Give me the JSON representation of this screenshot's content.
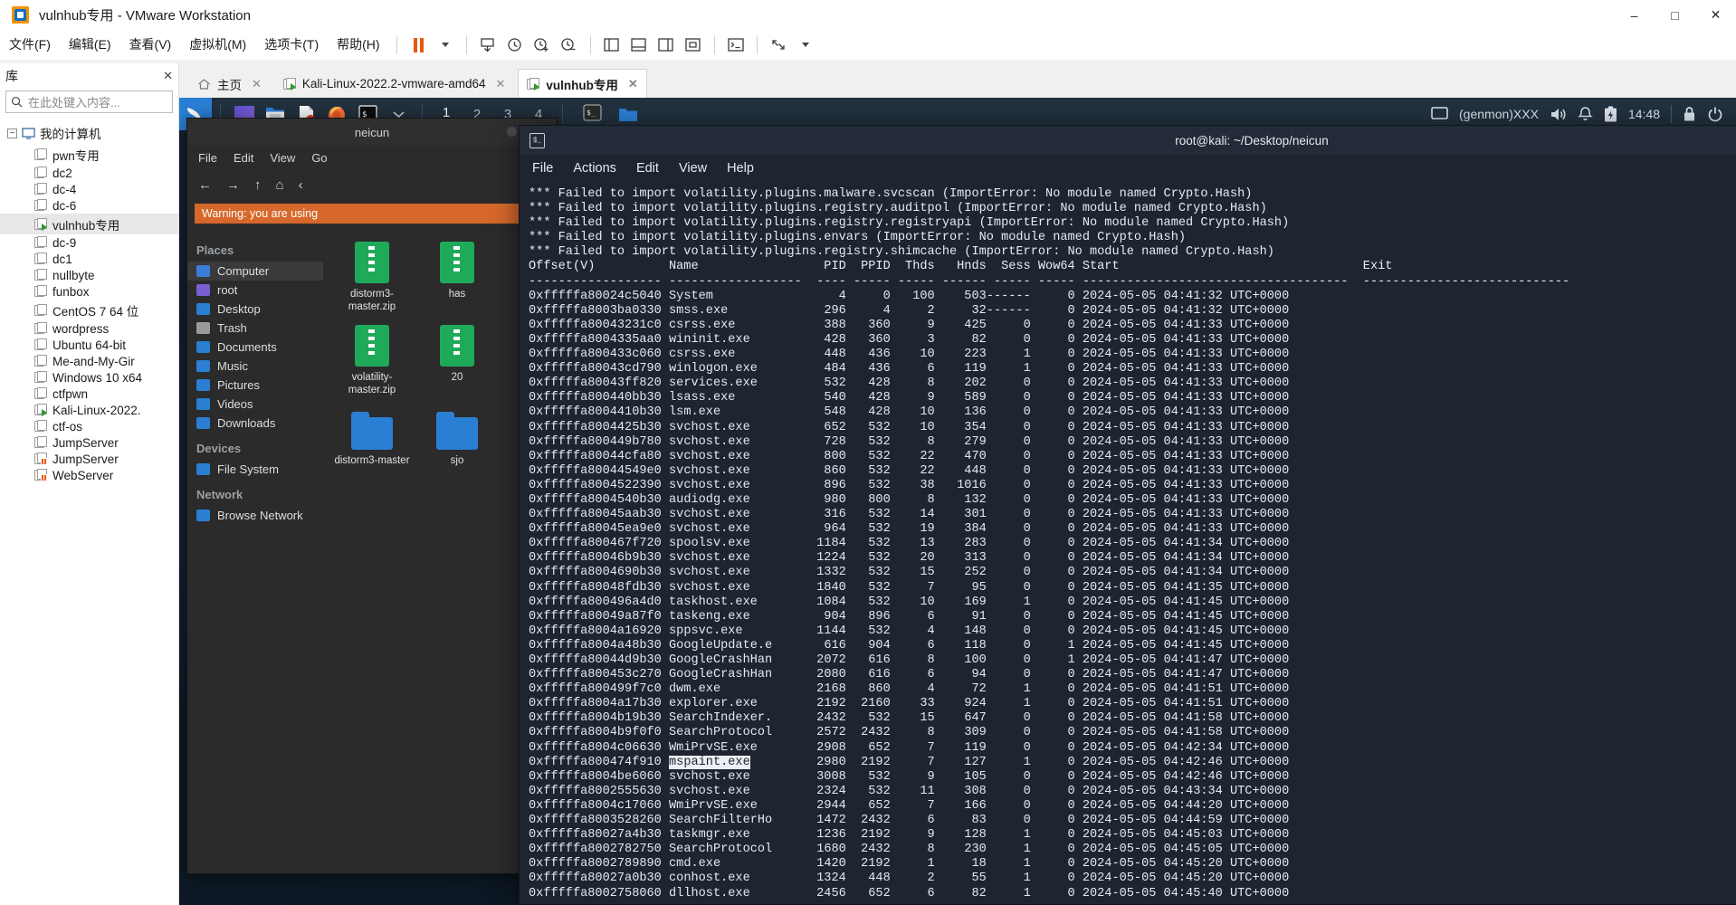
{
  "window": {
    "title": "vulnhub专用 - VMware Workstation",
    "controls": {
      "minimize": "–",
      "maximize": "□",
      "close": "✕"
    }
  },
  "menubar": {
    "items": [
      {
        "label": "文件(F)",
        "name": "menu-file"
      },
      {
        "label": "编辑(E)",
        "name": "menu-edit"
      },
      {
        "label": "查看(V)",
        "name": "menu-view"
      },
      {
        "label": "虚拟机(M)",
        "name": "menu-vm"
      },
      {
        "label": "选项卡(T)",
        "name": "menu-tabs"
      },
      {
        "label": "帮助(H)",
        "name": "menu-help"
      }
    ]
  },
  "library": {
    "header": "库",
    "close_label": "✕",
    "search_placeholder": "在此处键入内容...",
    "root": "我的计算机",
    "items": [
      {
        "label": "pwn专用",
        "state": "off"
      },
      {
        "label": "dc2",
        "state": "off"
      },
      {
        "label": "dc-4",
        "state": "off"
      },
      {
        "label": "dc-6",
        "state": "off"
      },
      {
        "label": "vulnhub专用",
        "state": "running",
        "selected": true
      },
      {
        "label": "dc-9",
        "state": "off"
      },
      {
        "label": "dc1",
        "state": "off"
      },
      {
        "label": "nullbyte",
        "state": "off"
      },
      {
        "label": "funbox",
        "state": "off"
      },
      {
        "label": "CentOS 7 64 位",
        "state": "off"
      },
      {
        "label": "wordpress",
        "state": "off"
      },
      {
        "label": "Ubuntu 64-bit",
        "state": "off"
      },
      {
        "label": "Me-and-My-Gir",
        "state": "off"
      },
      {
        "label": "Windows 10 x64",
        "state": "off"
      },
      {
        "label": "ctfpwn",
        "state": "off"
      },
      {
        "label": "Kali-Linux-2022.",
        "state": "running"
      },
      {
        "label": "ctf-os",
        "state": "off"
      },
      {
        "label": "JumpServer",
        "state": "off"
      },
      {
        "label": "JumpServer",
        "state": "suspended"
      },
      {
        "label": "WebServer",
        "state": "suspended"
      }
    ]
  },
  "tabs": [
    {
      "label": "主页",
      "icon": "home-icon",
      "active": false
    },
    {
      "label": "Kali-Linux-2022.2-vmware-amd64",
      "icon": "vm-icon",
      "active": false
    },
    {
      "label": "vulnhub专用",
      "icon": "vm-icon",
      "active": true
    }
  ],
  "guest": {
    "panel": {
      "workspaces": [
        "1",
        "2",
        "3",
        "4"
      ],
      "active_workspace": "1",
      "tray": {
        "genmon": "(genmon)XXX",
        "clock": "14:48"
      }
    },
    "file_manager": {
      "title": "neicun",
      "path_title": "neicun",
      "menu": [
        "File",
        "Edit",
        "View",
        "Go"
      ],
      "warning": "Warning: you are using",
      "places_label": "Places",
      "places": [
        "Computer",
        "root",
        "Desktop",
        "Trash",
        "Documents",
        "Music",
        "Pictures",
        "Videos",
        "Downloads"
      ],
      "devices_label": "Devices",
      "devices": [
        "File System"
      ],
      "network_label": "Network",
      "network": [
        "Browse Network"
      ],
      "files": [
        {
          "name": "distorm3-master.zip",
          "type": "zip"
        },
        {
          "name": "has",
          "type": "zip"
        },
        {
          "name": "volatility-master.zip",
          "type": "zip"
        },
        {
          "name": "20",
          "type": "zip"
        },
        {
          "name": "distorm3-master",
          "type": "folder"
        },
        {
          "name": "sjo",
          "type": "folder"
        }
      ]
    },
    "terminal": {
      "title": "root@kali: ~/Desktop/neicun",
      "menu": [
        "File",
        "Actions",
        "Edit",
        "View",
        "Help"
      ],
      "errors": [
        "*** Failed to import volatility.plugins.malware.svcscan (ImportError: No module named Crypto.Hash)",
        "*** Failed to import volatility.plugins.registry.auditpol (ImportError: No module named Crypto.Hash)",
        "*** Failed to import volatility.plugins.registry.registryapi (ImportError: No module named Crypto.Hash)",
        "*** Failed to import volatility.plugins.envars (ImportError: No module named Crypto.Hash)",
        "*** Failed to import volatility.plugins.registry.shimcache (ImportError: No module named Crypto.Hash)"
      ],
      "table": {
        "columns": [
          "Offset(V)",
          "Name",
          "PID",
          "PPID",
          "Thds",
          "Hnds",
          "Sess",
          "Wow64",
          "Start",
          "Exit"
        ],
        "rows": [
          {
            "offset": "0xfffffa80024c5040",
            "name": "System",
            "pid": "4",
            "ppid": "0",
            "thds": "100",
            "hnds": "503",
            "sess": "------",
            "wow64": "0",
            "start": "2024-05-05 04:41:32 UTC+0000"
          },
          {
            "offset": "0xfffffa8003ba0330",
            "name": "smss.exe",
            "pid": "296",
            "ppid": "4",
            "thds": "2",
            "hnds": "32",
            "sess": "------",
            "wow64": "0",
            "start": "2024-05-05 04:41:32 UTC+0000"
          },
          {
            "offset": "0xfffffa80043231c0",
            "name": "csrss.exe",
            "pid": "388",
            "ppid": "360",
            "thds": "9",
            "hnds": "425",
            "sess": "0",
            "wow64": "0",
            "start": "2024-05-05 04:41:33 UTC+0000"
          },
          {
            "offset": "0xfffffa8004335aa0",
            "name": "wininit.exe",
            "pid": "428",
            "ppid": "360",
            "thds": "3",
            "hnds": "82",
            "sess": "0",
            "wow64": "0",
            "start": "2024-05-05 04:41:33 UTC+0000"
          },
          {
            "offset": "0xfffffa800433c060",
            "name": "csrss.exe",
            "pid": "448",
            "ppid": "436",
            "thds": "10",
            "hnds": "223",
            "sess": "1",
            "wow64": "0",
            "start": "2024-05-05 04:41:33 UTC+0000"
          },
          {
            "offset": "0xfffffa80043cd790",
            "name": "winlogon.exe",
            "pid": "484",
            "ppid": "436",
            "thds": "6",
            "hnds": "119",
            "sess": "1",
            "wow64": "0",
            "start": "2024-05-05 04:41:33 UTC+0000"
          },
          {
            "offset": "0xfffffa80043ff820",
            "name": "services.exe",
            "pid": "532",
            "ppid": "428",
            "thds": "8",
            "hnds": "202",
            "sess": "0",
            "wow64": "0",
            "start": "2024-05-05 04:41:33 UTC+0000"
          },
          {
            "offset": "0xfffffa800440bb30",
            "name": "lsass.exe",
            "pid": "540",
            "ppid": "428",
            "thds": "9",
            "hnds": "589",
            "sess": "0",
            "wow64": "0",
            "start": "2024-05-05 04:41:33 UTC+0000"
          },
          {
            "offset": "0xfffffa8004410b30",
            "name": "lsm.exe",
            "pid": "548",
            "ppid": "428",
            "thds": "10",
            "hnds": "136",
            "sess": "0",
            "wow64": "0",
            "start": "2024-05-05 04:41:33 UTC+0000"
          },
          {
            "offset": "0xfffffa8004425b30",
            "name": "svchost.exe",
            "pid": "652",
            "ppid": "532",
            "thds": "10",
            "hnds": "354",
            "sess": "0",
            "wow64": "0",
            "start": "2024-05-05 04:41:33 UTC+0000"
          },
          {
            "offset": "0xfffffa800449b780",
            "name": "svchost.exe",
            "pid": "728",
            "ppid": "532",
            "thds": "8",
            "hnds": "279",
            "sess": "0",
            "wow64": "0",
            "start": "2024-05-05 04:41:33 UTC+0000"
          },
          {
            "offset": "0xfffffa80044cfa80",
            "name": "svchost.exe",
            "pid": "800",
            "ppid": "532",
            "thds": "22",
            "hnds": "470",
            "sess": "0",
            "wow64": "0",
            "start": "2024-05-05 04:41:33 UTC+0000"
          },
          {
            "offset": "0xfffffa80044549e0",
            "name": "svchost.exe",
            "pid": "860",
            "ppid": "532",
            "thds": "22",
            "hnds": "448",
            "sess": "0",
            "wow64": "0",
            "start": "2024-05-05 04:41:33 UTC+0000"
          },
          {
            "offset": "0xfffffa8004522390",
            "name": "svchost.exe",
            "pid": "896",
            "ppid": "532",
            "thds": "38",
            "hnds": "1016",
            "sess": "0",
            "wow64": "0",
            "start": "2024-05-05 04:41:33 UTC+0000"
          },
          {
            "offset": "0xfffffa8004540b30",
            "name": "audiodg.exe",
            "pid": "980",
            "ppid": "800",
            "thds": "8",
            "hnds": "132",
            "sess": "0",
            "wow64": "0",
            "start": "2024-05-05 04:41:33 UTC+0000"
          },
          {
            "offset": "0xfffffa80045aab30",
            "name": "svchost.exe",
            "pid": "316",
            "ppid": "532",
            "thds": "14",
            "hnds": "301",
            "sess": "0",
            "wow64": "0",
            "start": "2024-05-05 04:41:33 UTC+0000"
          },
          {
            "offset": "0xfffffa80045ea9e0",
            "name": "svchost.exe",
            "pid": "964",
            "ppid": "532",
            "thds": "19",
            "hnds": "384",
            "sess": "0",
            "wow64": "0",
            "start": "2024-05-05 04:41:33 UTC+0000"
          },
          {
            "offset": "0xfffffa800467f720",
            "name": "spoolsv.exe",
            "pid": "1184",
            "ppid": "532",
            "thds": "13",
            "hnds": "283",
            "sess": "0",
            "wow64": "0",
            "start": "2024-05-05 04:41:34 UTC+0000"
          },
          {
            "offset": "0xfffffa80046b9b30",
            "name": "svchost.exe",
            "pid": "1224",
            "ppid": "532",
            "thds": "20",
            "hnds": "313",
            "sess": "0",
            "wow64": "0",
            "start": "2024-05-05 04:41:34 UTC+0000"
          },
          {
            "offset": "0xfffffa8004690b30",
            "name": "svchost.exe",
            "pid": "1332",
            "ppid": "532",
            "thds": "15",
            "hnds": "252",
            "sess": "0",
            "wow64": "0",
            "start": "2024-05-05 04:41:34 UTC+0000"
          },
          {
            "offset": "0xfffffa80048fdb30",
            "name": "svchost.exe",
            "pid": "1840",
            "ppid": "532",
            "thds": "7",
            "hnds": "95",
            "sess": "0",
            "wow64": "0",
            "start": "2024-05-05 04:41:35 UTC+0000"
          },
          {
            "offset": "0xfffffa800496a4d0",
            "name": "taskhost.exe",
            "pid": "1084",
            "ppid": "532",
            "thds": "10",
            "hnds": "169",
            "sess": "1",
            "wow64": "0",
            "start": "2024-05-05 04:41:45 UTC+0000"
          },
          {
            "offset": "0xfffffa80049a87f0",
            "name": "taskeng.exe",
            "pid": "904",
            "ppid": "896",
            "thds": "6",
            "hnds": "91",
            "sess": "0",
            "wow64": "0",
            "start": "2024-05-05 04:41:45 UTC+0000"
          },
          {
            "offset": "0xfffffa8004a16920",
            "name": "sppsvc.exe",
            "pid": "1144",
            "ppid": "532",
            "thds": "4",
            "hnds": "148",
            "sess": "0",
            "wow64": "0",
            "start": "2024-05-05 04:41:45 UTC+0000"
          },
          {
            "offset": "0xfffffa8004a48b30",
            "name": "GoogleUpdate.e",
            "pid": "616",
            "ppid": "904",
            "thds": "6",
            "hnds": "118",
            "sess": "0",
            "wow64": "1",
            "start": "2024-05-05 04:41:45 UTC+0000"
          },
          {
            "offset": "0xfffffa80044d9b30",
            "name": "GoogleCrashHan",
            "pid": "2072",
            "ppid": "616",
            "thds": "8",
            "hnds": "100",
            "sess": "0",
            "wow64": "1",
            "start": "2024-05-05 04:41:47 UTC+0000"
          },
          {
            "offset": "0xfffffa800453c270",
            "name": "GoogleCrashHan",
            "pid": "2080",
            "ppid": "616",
            "thds": "6",
            "hnds": "94",
            "sess": "0",
            "wow64": "0",
            "start": "2024-05-05 04:41:47 UTC+0000"
          },
          {
            "offset": "0xfffffa800499f7c0",
            "name": "dwm.exe",
            "pid": "2168",
            "ppid": "860",
            "thds": "4",
            "hnds": "72",
            "sess": "1",
            "wow64": "0",
            "start": "2024-05-05 04:41:51 UTC+0000"
          },
          {
            "offset": "0xfffffa8004a17b30",
            "name": "explorer.exe",
            "pid": "2192",
            "ppid": "2160",
            "thds": "33",
            "hnds": "924",
            "sess": "1",
            "wow64": "0",
            "start": "2024-05-05 04:41:51 UTC+0000"
          },
          {
            "offset": "0xfffffa8004b19b30",
            "name": "SearchIndexer.",
            "pid": "2432",
            "ppid": "532",
            "thds": "15",
            "hnds": "647",
            "sess": "0",
            "wow64": "0",
            "start": "2024-05-05 04:41:58 UTC+0000"
          },
          {
            "offset": "0xfffffa8004b9f0f0",
            "name": "SearchProtocol",
            "pid": "2572",
            "ppid": "2432",
            "thds": "8",
            "hnds": "309",
            "sess": "0",
            "wow64": "0",
            "start": "2024-05-05 04:41:58 UTC+0000"
          },
          {
            "offset": "0xfffffa8004c06630",
            "name": "WmiPrvSE.exe",
            "pid": "2908",
            "ppid": "652",
            "thds": "7",
            "hnds": "119",
            "sess": "0",
            "wow64": "0",
            "start": "2024-05-05 04:42:34 UTC+0000"
          },
          {
            "offset": "0xfffffa800474f910",
            "name": "mspaint.exe",
            "pid": "2980",
            "ppid": "2192",
            "thds": "7",
            "hnds": "127",
            "sess": "1",
            "wow64": "0",
            "start": "2024-05-05 04:42:46 UTC+0000",
            "highlight": true
          },
          {
            "offset": "0xfffffa8004be6060",
            "name": "svchost.exe",
            "pid": "3008",
            "ppid": "532",
            "thds": "9",
            "hnds": "105",
            "sess": "0",
            "wow64": "0",
            "start": "2024-05-05 04:42:46 UTC+0000"
          },
          {
            "offset": "0xfffffa8002555630",
            "name": "svchost.exe",
            "pid": "2324",
            "ppid": "532",
            "thds": "11",
            "hnds": "308",
            "sess": "0",
            "wow64": "0",
            "start": "2024-05-05 04:43:34 UTC+0000"
          },
          {
            "offset": "0xfffffa8004c17060",
            "name": "WmiPrvSE.exe",
            "pid": "2944",
            "ppid": "652",
            "thds": "7",
            "hnds": "166",
            "sess": "0",
            "wow64": "0",
            "start": "2024-05-05 04:44:20 UTC+0000"
          },
          {
            "offset": "0xfffffa8003528260",
            "name": "SearchFilterHo",
            "pid": "1472",
            "ppid": "2432",
            "thds": "6",
            "hnds": "83",
            "sess": "0",
            "wow64": "0",
            "start": "2024-05-05 04:44:59 UTC+0000"
          },
          {
            "offset": "0xfffffa80027a4b30",
            "name": "taskmgr.exe",
            "pid": "1236",
            "ppid": "2192",
            "thds": "9",
            "hnds": "128",
            "sess": "1",
            "wow64": "0",
            "start": "2024-05-05 04:45:03 UTC+0000"
          },
          {
            "offset": "0xfffffa8002782750",
            "name": "SearchProtocol",
            "pid": "1680",
            "ppid": "2432",
            "thds": "8",
            "hnds": "230",
            "sess": "1",
            "wow64": "0",
            "start": "2024-05-05 04:45:05 UTC+0000"
          },
          {
            "offset": "0xfffffa8002789890",
            "name": "cmd.exe",
            "pid": "1420",
            "ppid": "2192",
            "thds": "1",
            "hnds": "18",
            "sess": "1",
            "wow64": "0",
            "start": "2024-05-05 04:45:20 UTC+0000"
          },
          {
            "offset": "0xfffffa80027a0b30",
            "name": "conhost.exe",
            "pid": "1324",
            "ppid": "448",
            "thds": "2",
            "hnds": "55",
            "sess": "1",
            "wow64": "0",
            "start": "2024-05-05 04:45:20 UTC+0000"
          },
          {
            "offset": "0xfffffa8002758060",
            "name": "dllhost.exe",
            "pid": "2456",
            "ppid": "652",
            "thds": "6",
            "hnds": "82",
            "sess": "1",
            "wow64": "0",
            "start": "2024-05-05 04:45:40 UTC+0000"
          }
        ]
      }
    }
  },
  "colors": {
    "accent": "#2a7fd4",
    "panel": "#22313f",
    "terminal_bg": "#1e2430",
    "warning": "#d6682b",
    "running": "#2e9b2e",
    "suspended": "#e8590c"
  }
}
